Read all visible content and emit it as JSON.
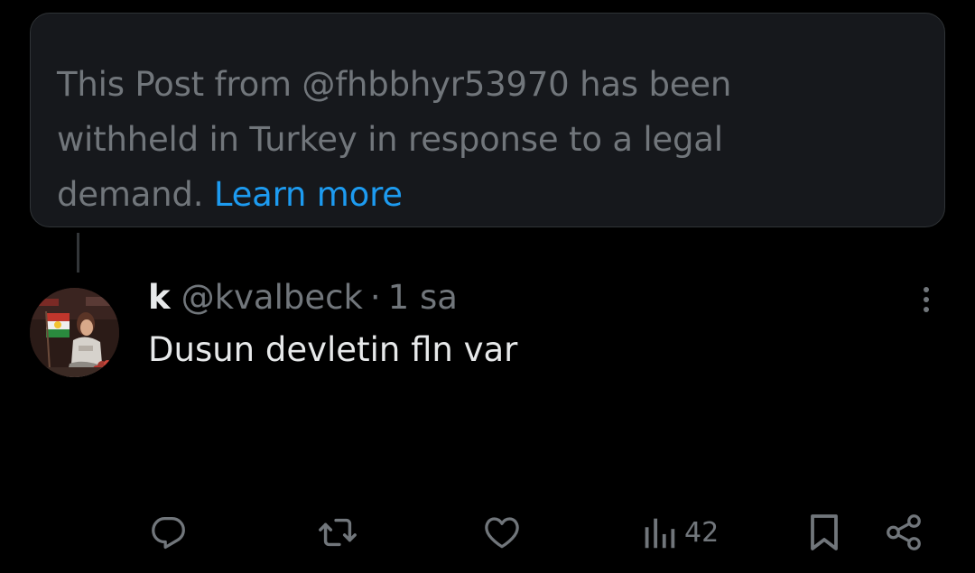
{
  "notice": {
    "text_before_link": "This Post from @fhbbhyr53970 has been withheld in Turkey in response to a legal demand. ",
    "link_text": "Learn more"
  },
  "post": {
    "display_name": "k",
    "handle": "@kvalbeck",
    "separator": "·",
    "timestamp": "1 sa",
    "text": "Dusun devletin fln var"
  },
  "actions": {
    "reply_icon": "reply-icon",
    "repost_icon": "repost-icon",
    "like_icon": "heart-icon",
    "views_icon": "views-bars-icon",
    "views_count": "42",
    "bookmark_icon": "bookmark-icon",
    "share_icon": "share-icon"
  },
  "colors": {
    "background": "#000000",
    "notice_background": "#16181c",
    "notice_border": "#2f3336",
    "muted_text": "#71767b",
    "primary_text": "#e7e9ea",
    "link": "#1d9bf0"
  }
}
